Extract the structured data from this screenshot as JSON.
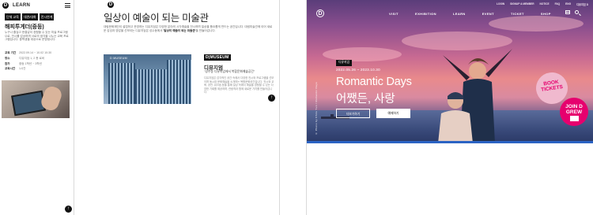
{
  "mobile": {
    "logo": "D",
    "section": "LEARN",
    "tabs": [
      "단체 교육",
      "대관/대화",
      "전시연계"
    ],
    "title": "해피투게더(중등)",
    "description": "누구나 즐겁고 한결같이 경험할 수 있는 미술 프로그램으로, 전시를 감상하며 서로의 생각을 나누는 교육 프로그램입니다. 중학생을 대상으로 운영됩니다.",
    "info": [
      {
        "label": "교육 기간",
        "value": "2022.09.14 ~ 10.02 10:30"
      },
      {
        "label": "장소",
        "value": "디뮤지엄 1, 2 층 로비"
      },
      {
        "label": "참가",
        "value": "중등 1학년 ~ 3학년"
      },
      {
        "label": "교육시간",
        "value": "1시간"
      }
    ],
    "arrow": "↑"
  },
  "desktop": {
    "logo": "D",
    "title": "일상이 예술이 되는 미술관",
    "intro_plain": "대림문화재단이 설립하고 운영하는 디뮤지엄은 다양한 분야의 시각예술을 전시하며 일상을 풍요롭게 만드는 공간입니다. 대림미술관에 이어 새로운 감성과 영감을 선보이는 디뮤지엄은 성수동에서 ",
    "intro_bold": "'일상이 예술이 되는 미술관'",
    "intro_end": "을 만들어갑니다.",
    "image_tag": "D MUSEUM",
    "badge": "D|MUSEUM",
    "name": "디뮤지엄",
    "tagline": "\"성수동 디뮤지엄에서 복합문화예술공간\"",
    "description": "디뮤지엄은 감각적인 공간 속에서 다양한 전시와 프로그램을 선보이며 동시대 문화예술을 소개하는 복합문화공간입니다. 전시와 교육, 공연, 워크숍 등을 통해 일상 속에서 예술을 경험할 수 있는 다양한 기회를 제공하며, 관람객과 함께 새로운 가치를 만들어갑니다.",
    "arrow": "↑"
  },
  "hero": {
    "util_nav": [
      "LOGIN",
      "SIGNUP & MEMBER",
      "NOTICE",
      "FAQ",
      "ENG",
      "디뮤지엄 D"
    ],
    "gnb": [
      "VISIT",
      "EXHIBITION",
      "LEARN",
      "EVENT",
      "TICKET",
      "SHOP"
    ],
    "logo": "D",
    "badge": "디뮤지엄",
    "date": "2022.05.26 ~ 2023.10.30",
    "title": "Romantic Days",
    "subtitle": "어쨌든, 사랑",
    "btn_more": "더보기하기",
    "btn_buy": "예매하기",
    "credit": "© Photo by Chris Yun / Romantic Days",
    "sticker_book": "BOOK TICKETS",
    "sticker_join": "JOIN D GREW"
  }
}
